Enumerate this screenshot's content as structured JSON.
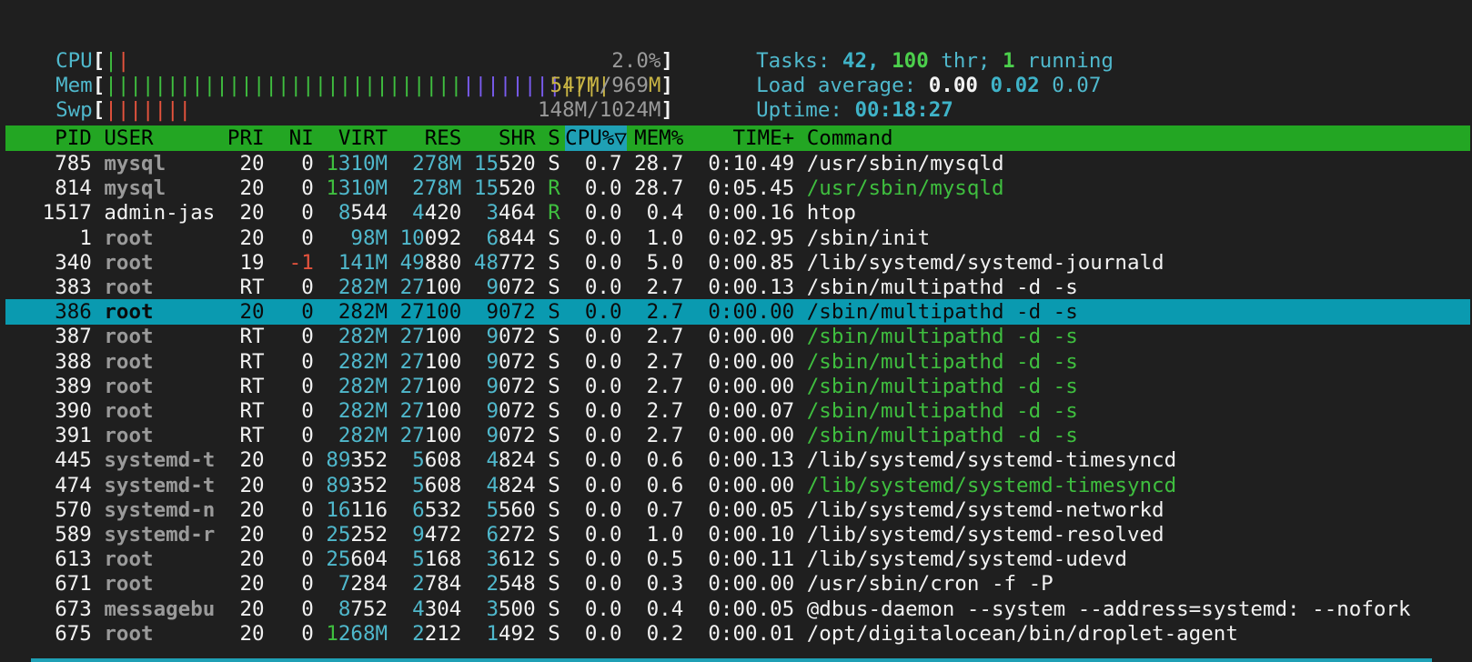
{
  "meters": {
    "cpu": {
      "label": "CPU",
      "bars": [
        {
          "color": "green",
          "text": "|"
        },
        {
          "color": "red",
          "text": "|"
        }
      ],
      "value": "2.0%"
    },
    "mem": {
      "label": "Mem",
      "bars": [
        {
          "color": "green",
          "text": "|||||||||||||||||||||||||||||"
        },
        {
          "color": "blue",
          "text": "||||||||"
        },
        {
          "color": "yellow",
          "text": "||||"
        }
      ],
      "value_a": "547M",
      "value_b": "/969",
      "value_c": "M"
    },
    "swp": {
      "label": "Swp",
      "bars": [
        {
          "color": "red",
          "text": "|||||||"
        }
      ],
      "value": "148M/1024M"
    }
  },
  "summary": {
    "tasks_label": "Tasks: ",
    "tasks_count": "42,",
    "thr_count": "100",
    "thr_label": " thr; ",
    "running_count": "1",
    "running_label": " running",
    "load_label": "Load average: ",
    "load1": "0.00",
    "load5": "0.02",
    "load15": "0.07",
    "uptime_label": "Uptime: ",
    "uptime": "00:18:27"
  },
  "columns": [
    "PID",
    "USER",
    "PRI",
    "NI",
    "VIRT",
    "RES",
    "SHR",
    "S",
    "CPU%▽",
    "MEM%",
    "TIME+",
    "Command"
  ],
  "processes": [
    {
      "pid": "785",
      "user": "mysql",
      "pri": "20",
      "ni": "0",
      "virt": "1310M",
      "res": "278M",
      "shr": "15520",
      "s": "S",
      "cpu": "0.7",
      "mem": "28.7",
      "time": "0:10.49",
      "cmd": "/usr/sbin/mysqld",
      "thread": false
    },
    {
      "pid": "814",
      "user": "mysql",
      "pri": "20",
      "ni": "0",
      "virt": "1310M",
      "res": "278M",
      "shr": "15520",
      "s": "R",
      "cpu": "0.0",
      "mem": "28.7",
      "time": "0:05.45",
      "cmd": "/usr/sbin/mysqld",
      "thread": true
    },
    {
      "pid": "1517",
      "user": "admin-jas",
      "pri": "20",
      "ni": "0",
      "virt": "8544",
      "res": "4420",
      "shr": "3464",
      "s": "R",
      "cpu": "0.0",
      "mem": "0.4",
      "time": "0:00.16",
      "cmd": "htop",
      "thread": false
    },
    {
      "pid": "1",
      "user": "root",
      "pri": "20",
      "ni": "0",
      "virt": "98M",
      "res": "10092",
      "shr": "6844",
      "s": "S",
      "cpu": "0.0",
      "mem": "1.0",
      "time": "0:02.95",
      "cmd": "/sbin/init",
      "thread": false
    },
    {
      "pid": "340",
      "user": "root",
      "pri": "19",
      "ni": "-1",
      "virt": "141M",
      "res": "49880",
      "shr": "48772",
      "s": "S",
      "cpu": "0.0",
      "mem": "5.0",
      "time": "0:00.85",
      "cmd": "/lib/systemd/systemd-journald",
      "thread": false
    },
    {
      "pid": "383",
      "user": "root",
      "pri": "RT",
      "ni": "0",
      "virt": "282M",
      "res": "27100",
      "shr": "9072",
      "s": "S",
      "cpu": "0.0",
      "mem": "2.7",
      "time": "0:00.13",
      "cmd": "/sbin/multipathd -d -s",
      "thread": false
    },
    {
      "pid": "386",
      "user": "root",
      "pri": "20",
      "ni": "0",
      "virt": "282M",
      "res": "27100",
      "shr": "9072",
      "s": "S",
      "cpu": "0.0",
      "mem": "2.7",
      "time": "0:00.00",
      "cmd": "/sbin/multipathd -d -s",
      "thread": false,
      "selected": true
    },
    {
      "pid": "387",
      "user": "root",
      "pri": "RT",
      "ni": "0",
      "virt": "282M",
      "res": "27100",
      "shr": "9072",
      "s": "S",
      "cpu": "0.0",
      "mem": "2.7",
      "time": "0:00.00",
      "cmd": "/sbin/multipathd -d -s",
      "thread": true
    },
    {
      "pid": "388",
      "user": "root",
      "pri": "RT",
      "ni": "0",
      "virt": "282M",
      "res": "27100",
      "shr": "9072",
      "s": "S",
      "cpu": "0.0",
      "mem": "2.7",
      "time": "0:00.00",
      "cmd": "/sbin/multipathd -d -s",
      "thread": true
    },
    {
      "pid": "389",
      "user": "root",
      "pri": "RT",
      "ni": "0",
      "virt": "282M",
      "res": "27100",
      "shr": "9072",
      "s": "S",
      "cpu": "0.0",
      "mem": "2.7",
      "time": "0:00.00",
      "cmd": "/sbin/multipathd -d -s",
      "thread": true
    },
    {
      "pid": "390",
      "user": "root",
      "pri": "RT",
      "ni": "0",
      "virt": "282M",
      "res": "27100",
      "shr": "9072",
      "s": "S",
      "cpu": "0.0",
      "mem": "2.7",
      "time": "0:00.07",
      "cmd": "/sbin/multipathd -d -s",
      "thread": true
    },
    {
      "pid": "391",
      "user": "root",
      "pri": "RT",
      "ni": "0",
      "virt": "282M",
      "res": "27100",
      "shr": "9072",
      "s": "S",
      "cpu": "0.0",
      "mem": "2.7",
      "time": "0:00.00",
      "cmd": "/sbin/multipathd -d -s",
      "thread": true
    },
    {
      "pid": "445",
      "user": "systemd-t",
      "pri": "20",
      "ni": "0",
      "virt": "89352",
      "res": "5608",
      "shr": "4824",
      "s": "S",
      "cpu": "0.0",
      "mem": "0.6",
      "time": "0:00.13",
      "cmd": "/lib/systemd/systemd-timesyncd",
      "thread": false
    },
    {
      "pid": "474",
      "user": "systemd-t",
      "pri": "20",
      "ni": "0",
      "virt": "89352",
      "res": "5608",
      "shr": "4824",
      "s": "S",
      "cpu": "0.0",
      "mem": "0.6",
      "time": "0:00.00",
      "cmd": "/lib/systemd/systemd-timesyncd",
      "thread": true
    },
    {
      "pid": "570",
      "user": "systemd-n",
      "pri": "20",
      "ni": "0",
      "virt": "16116",
      "res": "6532",
      "shr": "5560",
      "s": "S",
      "cpu": "0.0",
      "mem": "0.7",
      "time": "0:00.05",
      "cmd": "/lib/systemd/systemd-networkd",
      "thread": false
    },
    {
      "pid": "589",
      "user": "systemd-r",
      "pri": "20",
      "ni": "0",
      "virt": "25252",
      "res": "9472",
      "shr": "6272",
      "s": "S",
      "cpu": "0.0",
      "mem": "1.0",
      "time": "0:00.10",
      "cmd": "/lib/systemd/systemd-resolved",
      "thread": false
    },
    {
      "pid": "613",
      "user": "root",
      "pri": "20",
      "ni": "0",
      "virt": "25604",
      "res": "5168",
      "shr": "3612",
      "s": "S",
      "cpu": "0.0",
      "mem": "0.5",
      "time": "0:00.11",
      "cmd": "/lib/systemd/systemd-udevd",
      "thread": false
    },
    {
      "pid": "671",
      "user": "root",
      "pri": "20",
      "ni": "0",
      "virt": "7284",
      "res": "2784",
      "shr": "2548",
      "s": "S",
      "cpu": "0.0",
      "mem": "0.3",
      "time": "0:00.00",
      "cmd": "/usr/sbin/cron -f -P",
      "thread": false
    },
    {
      "pid": "673",
      "user": "messagebu",
      "pri": "20",
      "ni": "0",
      "virt": "8752",
      "res": "4304",
      "shr": "3500",
      "s": "S",
      "cpu": "0.0",
      "mem": "0.4",
      "time": "0:00.05",
      "cmd": "@dbus-daemon --system --address=systemd: --nofork",
      "thread": false
    },
    {
      "pid": "675",
      "user": "root",
      "pri": "20",
      "ni": "0",
      "virt": "1268M",
      "res": "2212",
      "shr": "1492",
      "s": "S",
      "cpu": "0.0",
      "mem": "0.2",
      "time": "0:00.01",
      "cmd": "/opt/digitalocean/bin/droplet-agent",
      "thread": false
    }
  ],
  "colors": {
    "background": "#1f1f1f",
    "header_bg": "#23a623",
    "selected_bg": "#0a9ab0",
    "sort_col_bg": "#1fa0b5",
    "cyan": "#4fb8cc",
    "green": "#3fbf3f",
    "red": "#e5533d",
    "gray": "#9a9a9a"
  }
}
